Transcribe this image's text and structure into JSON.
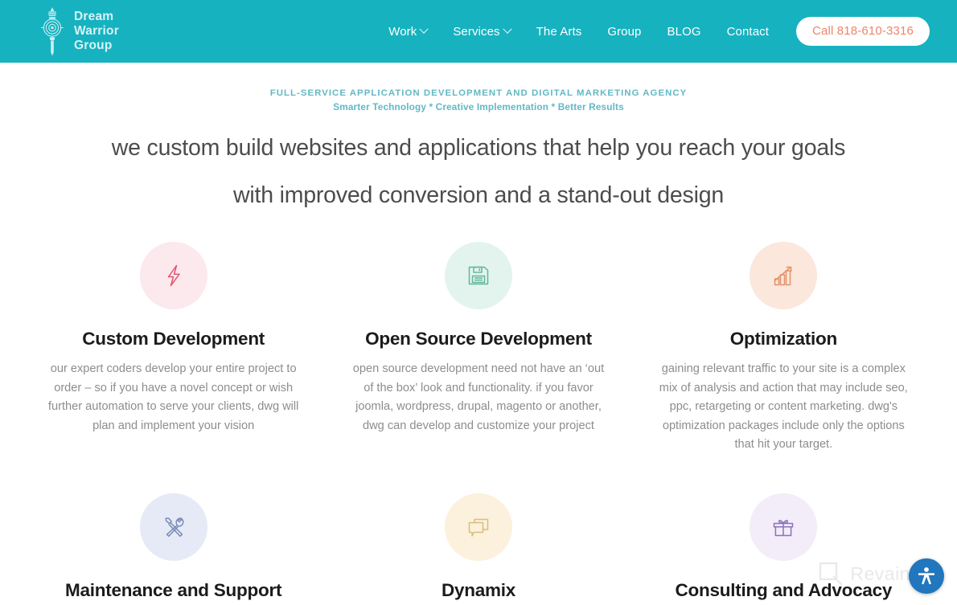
{
  "header": {
    "brand": {
      "icon": "vajra-mace-logo",
      "line1": "Dream",
      "line2": "Warrior",
      "line3": "Group"
    },
    "nav": [
      {
        "label": "Work",
        "has_dropdown": true,
        "icon": "chevron-down-icon"
      },
      {
        "label": "Services",
        "has_dropdown": true,
        "icon": "chevron-down-icon"
      },
      {
        "label": "The Arts",
        "has_dropdown": false
      },
      {
        "label": "Group",
        "has_dropdown": false
      },
      {
        "label": "BLOG",
        "has_dropdown": false
      },
      {
        "label": "Contact",
        "has_dropdown": false
      }
    ],
    "cta_label": "Call 818-610-3316",
    "bg_color": "#16b2c0",
    "cta_text_color": "#ef8468"
  },
  "hero": {
    "eyebrow": "FULL-SERVICE APPLICATION DEVELOPMENT AND DIGITAL MARKETING AGENCY",
    "subbrow": "Smarter Technology * Creative Implementation * Better Results",
    "headline_line1": "we custom build websites and applications that help you reach your goals",
    "headline_line2": "with improved conversion and a stand-out design",
    "accent_color": "#62b8c4"
  },
  "services": [
    {
      "icon": "lightning-bolt-icon",
      "circle_color": "#fbe9ee",
      "icon_color": "#e0576f",
      "title": "Custom Development",
      "body": "our expert coders develop your entire project to order – so if you have a novel concept or wish further automation to serve your clients, dwg will plan and implement your vision"
    },
    {
      "icon": "floppy-disk-save-icon",
      "circle_color": "#e3f4ee",
      "icon_color": "#63b798",
      "title": "Open Source Development",
      "body": "open source development need not have an ‘out of the box’ look and functionality. if you favor joomla, wordpress, drupal, magento or another, dwg can develop and customize your project"
    },
    {
      "icon": "bar-chart-growth-icon",
      "circle_color": "#fbe7dc",
      "icon_color": "#e3926a",
      "title": "Optimization",
      "body": "gaining relevant traffic to your site is a complex mix of analysis and action that may include seo, ppc, retargeting or content marketing. dwg's optimization packages include only the options that hit your target."
    },
    {
      "icon": "tools-wrench-screwdriver-icon",
      "circle_color": "#e6eaf6",
      "icon_color": "#7b8bb5",
      "title": "Maintenance and Support",
      "body": ""
    },
    {
      "icon": "chat-bubbles-icon",
      "circle_color": "#fbf1dc",
      "icon_color": "#d8bd7e",
      "title": "Dynamix",
      "body": ""
    },
    {
      "icon": "gift-box-icon",
      "circle_color": "#f3ecf9",
      "icon_color": "#8a73b8",
      "title": "Consulting and Advocacy",
      "body": ""
    }
  ],
  "widgets": {
    "accessibility_icon": "accessibility-person-icon",
    "accessibility_bg": "#2176bd",
    "watermark_text": "Revain",
    "watermark_icon": "revain-magnifier-logo"
  }
}
